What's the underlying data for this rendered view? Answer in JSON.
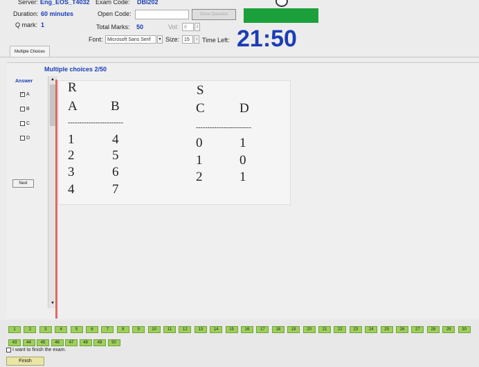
{
  "header": {
    "server_label": "Server:",
    "server_value": "Eng_EOS_T4032",
    "exam_code_label": "Exam Code:",
    "exam_code_value": "DBI202",
    "duration_label": "Duration:",
    "duration_value": "60 minutes",
    "open_code_label": "Open Code:",
    "show_question_label": "Show Question",
    "qmark_label": "Q mark:",
    "qmark_value": "1",
    "total_marks_label": "Total Marks:",
    "total_marks_value": "50",
    "vol_label": "Vol:",
    "vol_value": "8",
    "font_label": "Font:",
    "font_value": "Microsoft Sans Serif",
    "size_label": "Size:",
    "size_value": "15",
    "time_left_label": "Time Left:",
    "time_left_value": "21:50",
    "status_color": "#1ca03c"
  },
  "tab": {
    "label": "Multiple Choices"
  },
  "question": {
    "header": "Multiple choices 2/50",
    "answer_label": "Answer",
    "options": [
      {
        "label": "A",
        "checked": true
      },
      {
        "label": "B",
        "checked": false
      },
      {
        "label": "C",
        "checked": false
      },
      {
        "label": "D",
        "checked": false
      }
    ],
    "next_label": "Next",
    "table_r": {
      "name": "R",
      "columns": [
        "A",
        "B"
      ],
      "rule": "------------------------",
      "rows": [
        [
          "1",
          "4"
        ],
        [
          "2",
          "5"
        ],
        [
          "3",
          "6"
        ],
        [
          "4",
          "7"
        ]
      ]
    },
    "table_s": {
      "name": "S",
      "columns": [
        "C",
        "D"
      ],
      "rule": "------------------------",
      "rows": [
        [
          "0",
          "1"
        ],
        [
          "1",
          "0"
        ],
        [
          "2",
          "1"
        ]
      ]
    }
  },
  "question_nav": {
    "row1": [
      "1",
      "2",
      "3",
      "4",
      "5",
      "6",
      "7",
      "8",
      "9",
      "10",
      "11",
      "12",
      "13",
      "14",
      "15",
      "16",
      "17",
      "18",
      "19",
      "20",
      "21",
      "22",
      "23",
      "24",
      "25",
      "26",
      "27",
      "28",
      "29",
      "30"
    ],
    "row2": [
      "43",
      "44",
      "45",
      "46",
      "47",
      "48",
      "49",
      "50"
    ],
    "answered_color": "#9ed05a"
  },
  "footer": {
    "finish_check_label": "I want to finish the exam.",
    "finish_button_label": "Finish"
  }
}
